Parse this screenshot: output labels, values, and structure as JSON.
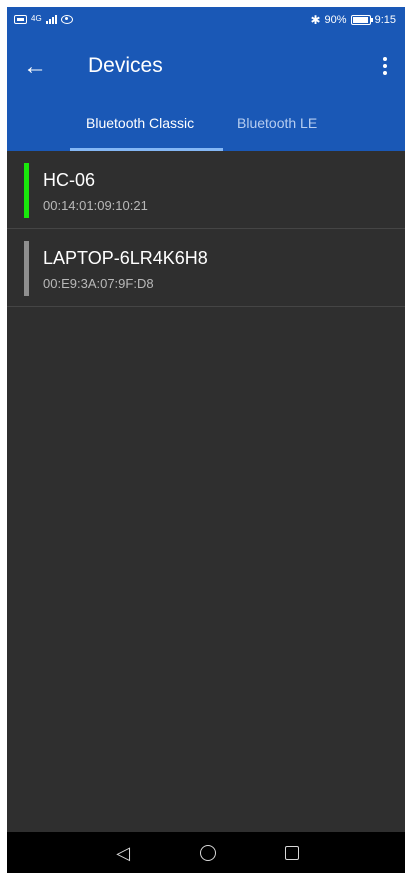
{
  "status_bar": {
    "network": "4G",
    "battery": "90%",
    "time": "9:15"
  },
  "app_bar": {
    "back_icon": "←",
    "title": "Devices",
    "menu_icon": "more-vert-icon"
  },
  "tabs": [
    {
      "label": "Bluetooth Classic",
      "selected": true
    },
    {
      "label": "Bluetooth LE",
      "selected": false
    }
  ],
  "devices": [
    {
      "name": "HC-06",
      "address": "00:14:01:09:10:21",
      "indicator_color": "#19e80b"
    },
    {
      "name": "LAPTOP-6LR4K6H8",
      "address": "00:E9:3A:07:9F:D8",
      "indicator_color": "#8f8f8f"
    }
  ],
  "colors": {
    "primary": "#1a58b6",
    "background": "#2f2f2f",
    "tab_indicator": "#84b7f5"
  },
  "nav": {
    "back_icon": "◁",
    "home_icon": "circle-icon",
    "recent_icon": "square-icon"
  }
}
